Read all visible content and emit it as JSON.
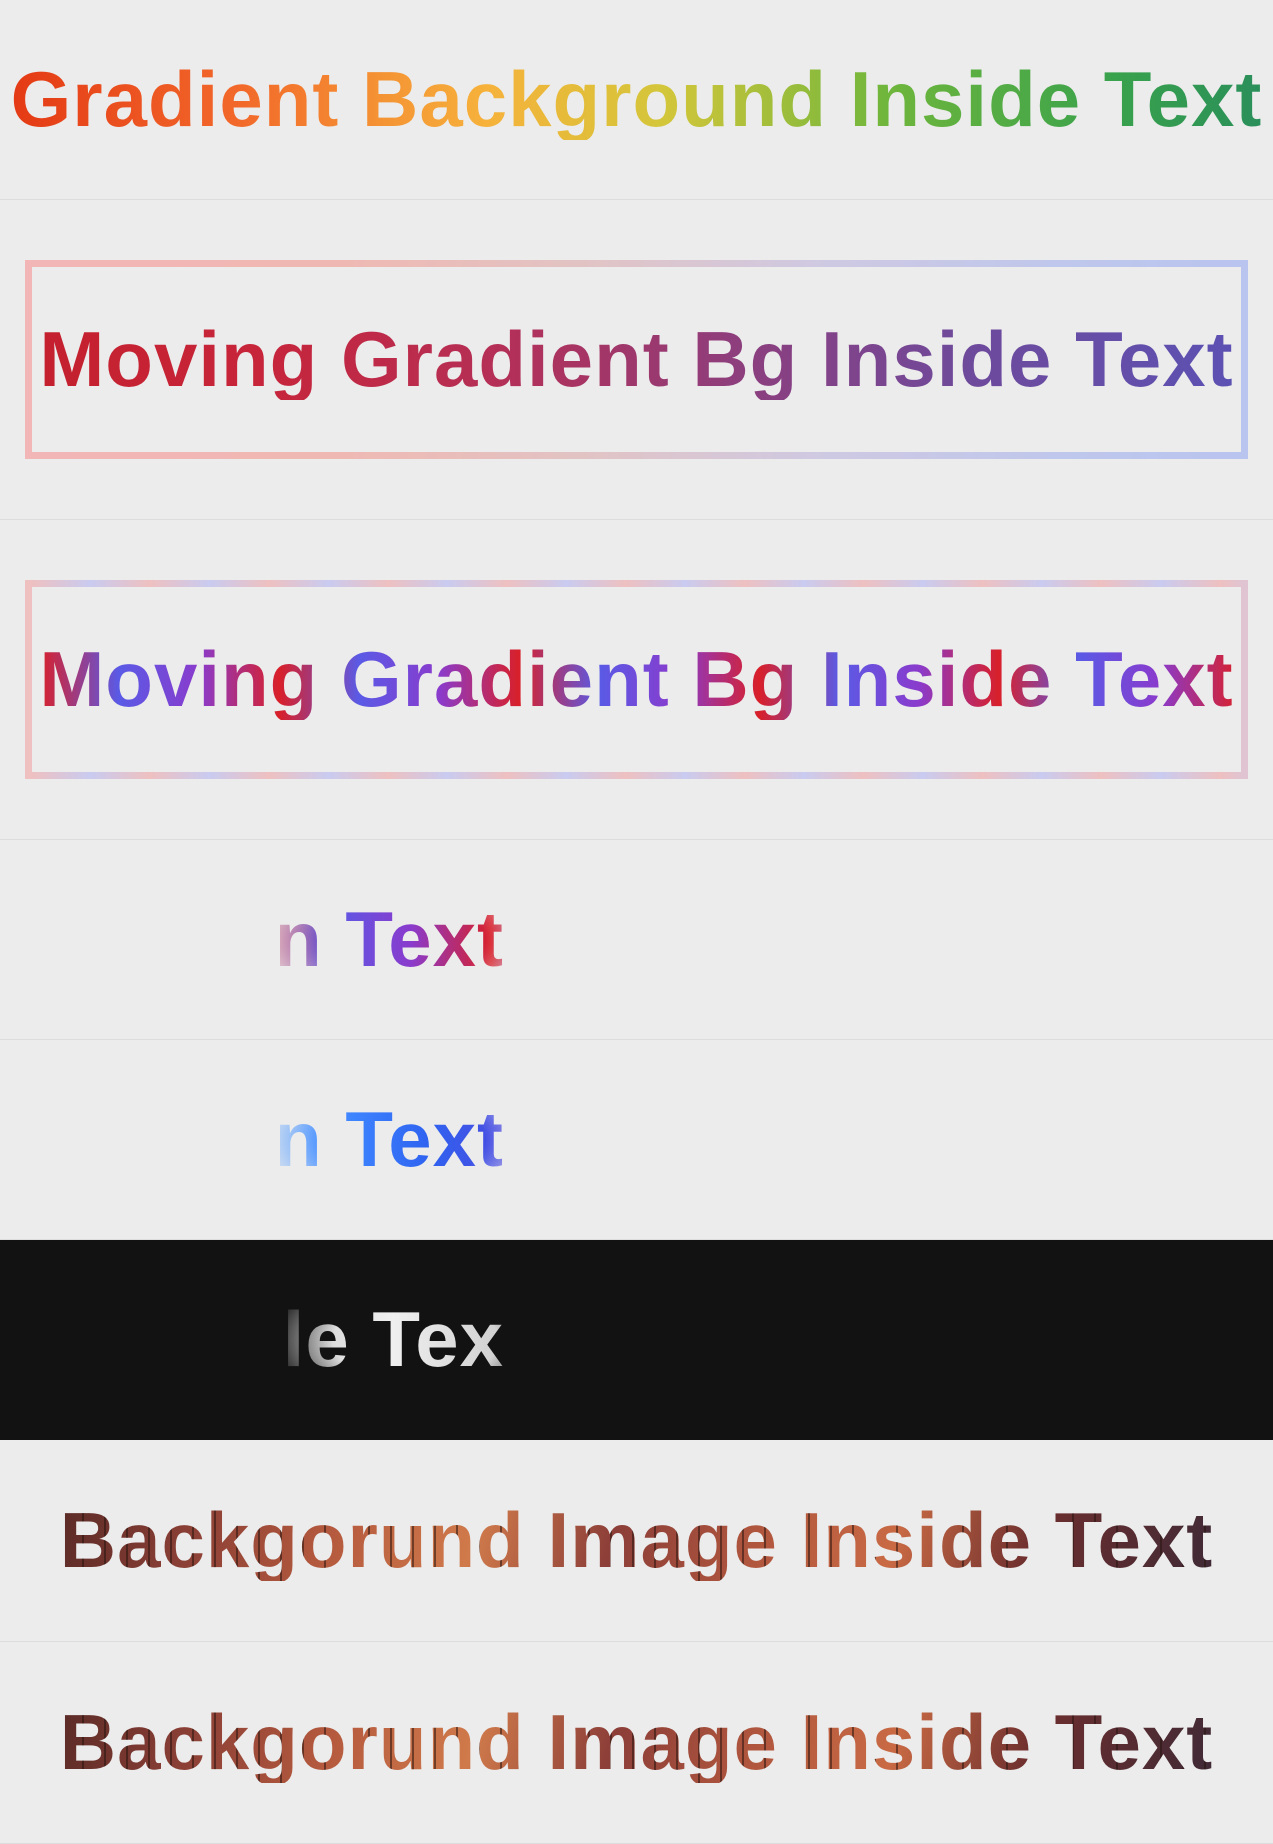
{
  "rows": {
    "r1": {
      "text": "Gradient Background Inside Text"
    },
    "r2": {
      "text": "Moving Gradient Bg Inside Text"
    },
    "r3": {
      "text": "Moving Gradient Bg Inside Text"
    },
    "r4": {
      "text": "In Text"
    },
    "r5": {
      "text": "In Text"
    },
    "r6": {
      "text": "le Tex"
    },
    "r7": {
      "text": "Backgorund Image Inside Text"
    },
    "r8": {
      "text": "Backgorund Image Inside Text"
    }
  }
}
